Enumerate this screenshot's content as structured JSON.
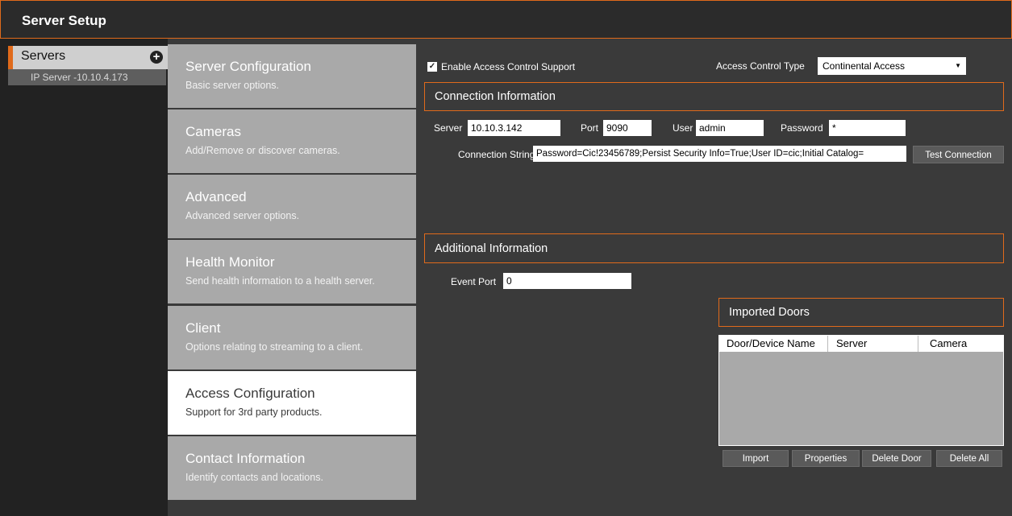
{
  "window": {
    "title": "Server Setup"
  },
  "sidebar": {
    "header": "Servers",
    "add_icon": "plus-circle-icon",
    "servers": [
      "IP Server -10.10.4.173"
    ]
  },
  "nav": [
    {
      "title": "Server Configuration",
      "subtitle": "Basic server options."
    },
    {
      "title": "Cameras",
      "subtitle": "Add/Remove or discover cameras."
    },
    {
      "title": "Advanced",
      "subtitle": "Advanced server options."
    },
    {
      "title": "Health Monitor",
      "subtitle": "Send health information to a health server."
    },
    {
      "title": "Client",
      "subtitle": "Options relating to streaming to a client."
    },
    {
      "title": "Access Configuration",
      "subtitle": "Support for 3rd party products."
    },
    {
      "title": "Contact Information",
      "subtitle": "Identify contacts and locations."
    }
  ],
  "access": {
    "enable_label": "Enable Access Control Support",
    "enable_checked": true,
    "type_label": "Access Control Type",
    "type_value": "Continental Access"
  },
  "connection": {
    "section_title": "Connection Information",
    "server_label": "Server",
    "server_value": "10.10.3.142",
    "port_label": "Port",
    "port_value": "9090",
    "user_label": "User",
    "user_value": "admin",
    "password_label": "Password",
    "password_value": "*",
    "conn_string_label": "Connection String",
    "conn_string_value": "Password=Cic!23456789;Persist Security Info=True;User ID=cic;Initial Catalog=",
    "test_button": "Test Connection"
  },
  "additional": {
    "section_title": "Additional Information",
    "event_port_label": "Event Port",
    "event_port_value": "0"
  },
  "doors": {
    "section_title": "Imported Doors",
    "columns": [
      "Door/Device Name",
      "Server",
      "Camera"
    ],
    "buttons": {
      "import": "Import",
      "properties": "Properties",
      "delete_door": "Delete Door",
      "delete_all": "Delete All"
    }
  },
  "colors": {
    "accent": "#e06a1b",
    "panel": "#3a3a3a",
    "nav_item": "#a9a9a9"
  }
}
